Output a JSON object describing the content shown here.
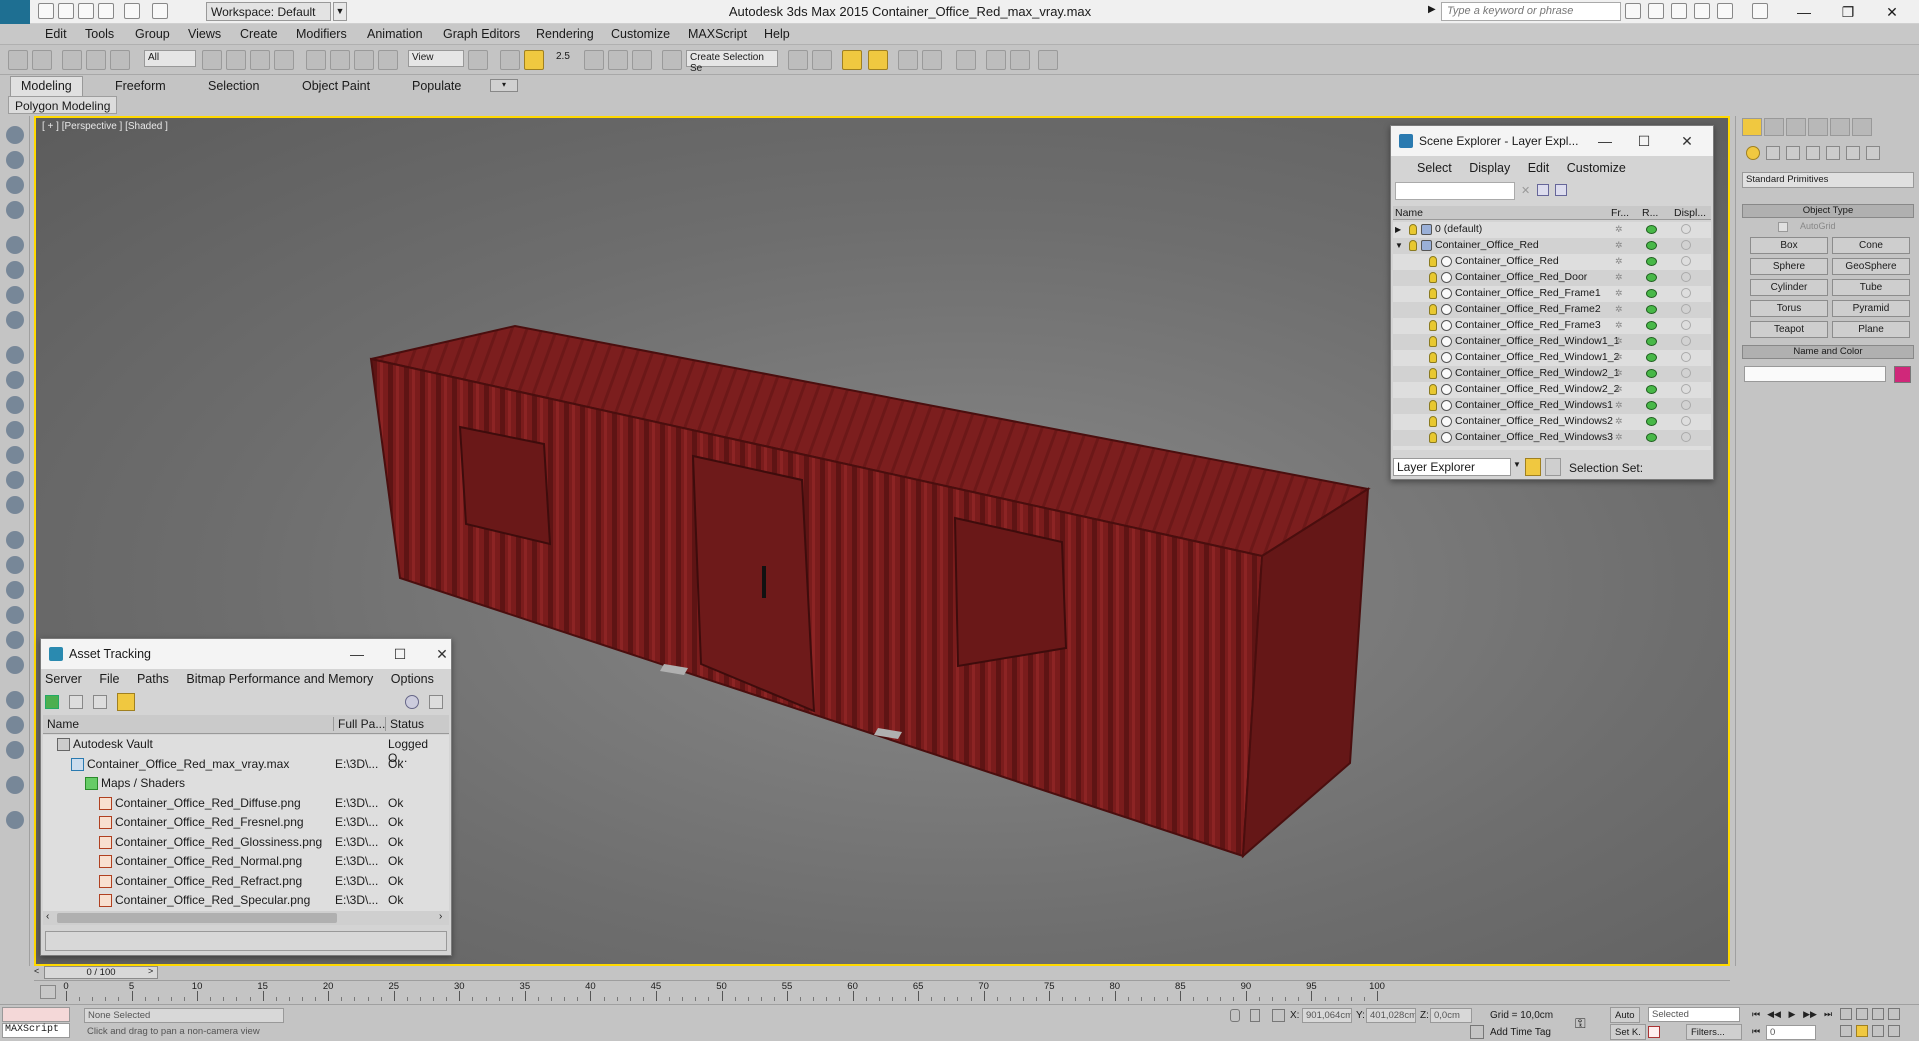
{
  "titlebar": {
    "app_logo": "MAX",
    "workspace": "Workspace: Default",
    "title": "Autodesk 3ds Max  2015    Container_Office_Red_max_vray.max",
    "search_placeholder": "Type a keyword or phrase"
  },
  "menu": [
    "Edit",
    "Tools",
    "Group",
    "Views",
    "Create",
    "Modifiers",
    "Animation",
    "Graph Editors",
    "Rendering",
    "Customize",
    "MAXScript",
    "Help"
  ],
  "toolbar": {
    "selection_filter": "All",
    "reference_coord": "View",
    "named_selection_placeholder": "Create Selection Se",
    "snap_label": "2.5"
  },
  "ribbon": {
    "tabs": [
      "Modeling",
      "Freeform",
      "Selection",
      "Object Paint",
      "Populate"
    ],
    "active_panel": "Polygon Modeling"
  },
  "viewport": {
    "label": "[ + ] [Perspective ] [Shaded ]",
    "object_color": "#7a1c1c"
  },
  "scene_explorer": {
    "title": "Scene Explorer - Layer Expl...",
    "menu": [
      "Select",
      "Display",
      "Edit",
      "Customize"
    ],
    "columns": [
      "Name",
      "Fr...",
      "R...",
      "Displ..."
    ],
    "rows": [
      {
        "name": "0 (default)",
        "level": 0,
        "type": "layer"
      },
      {
        "name": "Container_Office_Red",
        "level": 0,
        "type": "layer-open"
      },
      {
        "name": "Container_Office_Red",
        "level": 1,
        "type": "object"
      },
      {
        "name": "Container_Office_Red_Door",
        "level": 1,
        "type": "object"
      },
      {
        "name": "Container_Office_Red_Frame1",
        "level": 1,
        "type": "object"
      },
      {
        "name": "Container_Office_Red_Frame2",
        "level": 1,
        "type": "object"
      },
      {
        "name": "Container_Office_Red_Frame3",
        "level": 1,
        "type": "object"
      },
      {
        "name": "Container_Office_Red_Window1_1",
        "level": 1,
        "type": "object"
      },
      {
        "name": "Container_Office_Red_Window1_2",
        "level": 1,
        "type": "object"
      },
      {
        "name": "Container_Office_Red_Window2_1",
        "level": 1,
        "type": "object"
      },
      {
        "name": "Container_Office_Red_Window2_2",
        "level": 1,
        "type": "object"
      },
      {
        "name": "Container_Office_Red_Windows1",
        "level": 1,
        "type": "object"
      },
      {
        "name": "Container_Office_Red_Windows2",
        "level": 1,
        "type": "object"
      },
      {
        "name": "Container_Office_Red_Windows3",
        "level": 1,
        "type": "object"
      }
    ],
    "footer_dropdown": "Layer Explorer",
    "selection_set_label": "Selection Set:"
  },
  "asset_tracking": {
    "title": "Asset Tracking",
    "menu": [
      "Server",
      "File",
      "Paths",
      "Bitmap Performance and Memory",
      "Options"
    ],
    "columns": [
      "Name",
      "Full Pa...",
      "Status"
    ],
    "rows": [
      {
        "name": "Autodesk Vault",
        "path": "",
        "status": "Logged O...",
        "level": 0
      },
      {
        "name": "Container_Office_Red_max_vray.max",
        "path": "E:\\3D\\...",
        "status": "Ok",
        "level": 1
      },
      {
        "name": "Maps / Shaders",
        "path": "",
        "status": "",
        "level": 2
      },
      {
        "name": "Container_Office_Red_Diffuse.png",
        "path": "E:\\3D\\...",
        "status": "Ok",
        "level": 3
      },
      {
        "name": "Container_Office_Red_Fresnel.png",
        "path": "E:\\3D\\...",
        "status": "Ok",
        "level": 3
      },
      {
        "name": "Container_Office_Red_Glossiness.png",
        "path": "E:\\3D\\...",
        "status": "Ok",
        "level": 3
      },
      {
        "name": "Container_Office_Red_Normal.png",
        "path": "E:\\3D\\...",
        "status": "Ok",
        "level": 3
      },
      {
        "name": "Container_Office_Red_Refract.png",
        "path": "E:\\3D\\...",
        "status": "Ok",
        "level": 3
      },
      {
        "name": "Container_Office_Red_Specular.png",
        "path": "E:\\3D\\...",
        "status": "Ok",
        "level": 3
      }
    ]
  },
  "command_panel": {
    "dropdown": "Standard Primitives",
    "object_type_header": "Object Type",
    "autogrid": "AutoGrid",
    "buttons": [
      "Box",
      "Cone",
      "Sphere",
      "GeoSphere",
      "Cylinder",
      "Tube",
      "Torus",
      "Pyramid",
      "Teapot",
      "Plane"
    ],
    "name_color_header": "Name and Color",
    "swatch_color": "#d0287a"
  },
  "timeline": {
    "slider": "0 / 100",
    "ticks": [
      "0",
      "5",
      "10",
      "15",
      "20",
      "25",
      "30",
      "35",
      "40",
      "45",
      "50",
      "55",
      "60",
      "65",
      "70",
      "75",
      "80",
      "85",
      "90",
      "95",
      "100"
    ]
  },
  "status": {
    "maxscript": "MAXScript",
    "selection": "None Selected",
    "prompt": "Click and drag to pan a non-camera view",
    "x_label": "X:",
    "x_value": "901,064cm",
    "y_label": "Y:",
    "y_value": "401,028cm",
    "z_label": "Z:",
    "z_value": "0,0cm",
    "grid": "Grid = 10,0cm",
    "add_time_tag": "Add Time Tag",
    "auto": "Auto",
    "set_key": "Set K.",
    "selected_dropdown": "Selected",
    "filters": "Filters...",
    "frame": "0"
  }
}
